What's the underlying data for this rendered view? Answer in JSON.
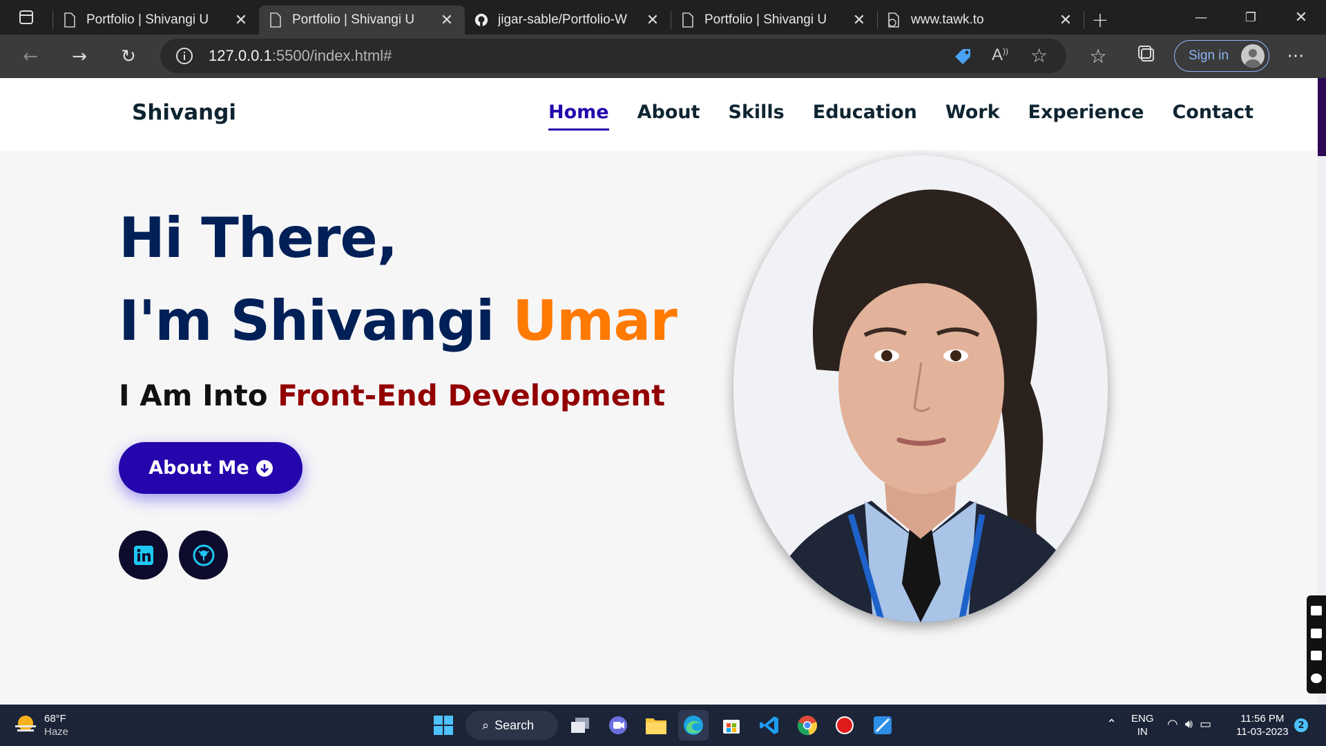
{
  "browser": {
    "tabs": [
      {
        "title": "Portfolio | Shivangi U",
        "favicon": "page-icon",
        "active": false
      },
      {
        "title": "Portfolio | Shivangi U",
        "favicon": "page-icon",
        "active": true
      },
      {
        "title": "jigar-sable/Portfolio-W",
        "favicon": "github-icon",
        "active": false
      },
      {
        "title": "Portfolio | Shivangi U",
        "favicon": "page-icon",
        "active": false
      },
      {
        "title": "www.tawk.to",
        "favicon": "page-error-icon",
        "active": false
      }
    ],
    "address": {
      "host": "127.0.0.1",
      "path": ":5500/index.html#"
    },
    "signin_label": "Sign in"
  },
  "site": {
    "brand": "Shivangi",
    "nav": [
      {
        "label": "Home",
        "active": true
      },
      {
        "label": "About"
      },
      {
        "label": "Skills"
      },
      {
        "label": "Education"
      },
      {
        "label": "Work"
      },
      {
        "label": "Experience"
      },
      {
        "label": "Contact"
      }
    ],
    "hero": {
      "line1": "Hi There,",
      "line2_prefix": "I'm Shivangi ",
      "line2_accent": "Umar",
      "tagline_prefix": "I Am Into ",
      "tagline_accent": "Front-End Development",
      "button_label": "About Me",
      "social": [
        "linkedin-icon",
        "github-icon"
      ]
    }
  },
  "taskbar": {
    "weather": {
      "temp": "68°F",
      "condition": "Haze"
    },
    "search_label": "Search",
    "language": {
      "line1": "ENG",
      "line2": "IN"
    },
    "time": "11:56 PM",
    "date": "11-03-2023",
    "notification_count": "2"
  },
  "colors": {
    "nav_active": "#2506ad",
    "heading": "#002057",
    "accent_orange": "#ff7a00",
    "accent_red": "#920000",
    "button": "#2506ad"
  }
}
